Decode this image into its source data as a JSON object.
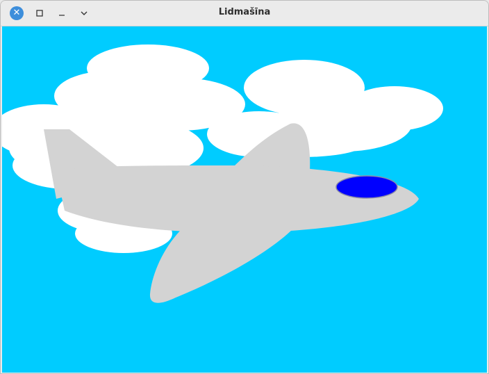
{
  "window": {
    "title": "Lidmašīna"
  },
  "controls": {
    "close_icon": "close-icon",
    "maximize_icon": "maximize-icon",
    "minimize_icon": "minimize-icon",
    "menu_icon": "chevron-down-icon"
  },
  "scene": {
    "sky_color": "#00ccff",
    "cloud_color": "#ffffff",
    "airplane_color": "#d3d3d3",
    "cockpit_color": "#0000ff"
  }
}
